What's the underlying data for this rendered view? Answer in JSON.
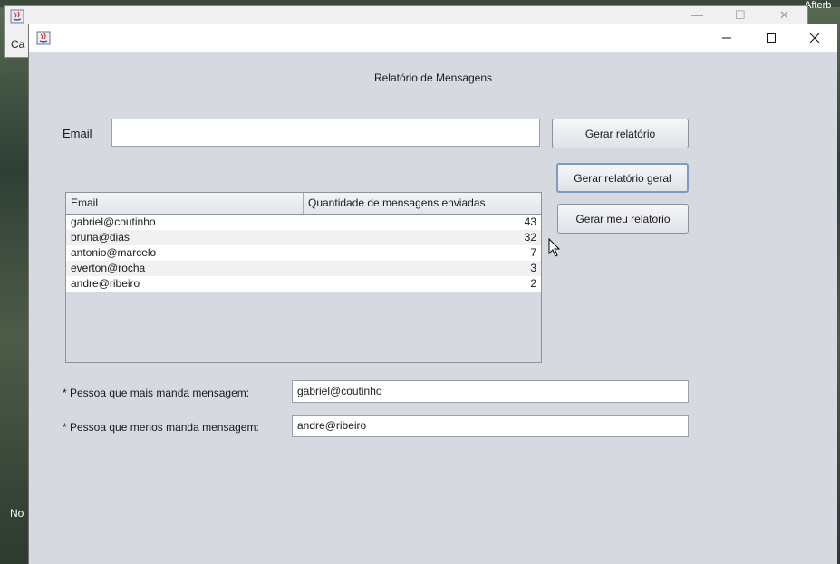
{
  "background": {
    "right_text": "Afterb",
    "left_label_top": "Ca",
    "left_label_bottom": "No"
  },
  "window": {
    "controls": {
      "minimize": "—",
      "maximize": "☐",
      "close": "✕"
    }
  },
  "page": {
    "title": "Relatório de Mensagens"
  },
  "search": {
    "label": "Email",
    "value": ""
  },
  "buttons": {
    "generate_report": "Gerar relatório",
    "generate_general_report": "Gerar relatório geral",
    "generate_my_report": "Gerar meu relatorio"
  },
  "table": {
    "headers": [
      "Email",
      "Quantidade de mensagens enviadas"
    ],
    "rows": [
      {
        "email": "gabriel@coutinho",
        "count": "43"
      },
      {
        "email": "bruna@dias",
        "count": "32"
      },
      {
        "email": "antonio@marcelo",
        "count": "7"
      },
      {
        "email": "everton@rocha",
        "count": "3"
      },
      {
        "email": "andre@ribeiro",
        "count": "2"
      }
    ]
  },
  "summary": {
    "most_label": "* Pessoa que mais manda mensagem:",
    "most_value": "gabriel@coutinho",
    "least_label": "* Pessoa que menos manda mensagem:",
    "least_value": "andre@ribeiro"
  },
  "colors": {
    "panel_bg": "#d6d9df",
    "focus_border": "#7a9cc6"
  }
}
